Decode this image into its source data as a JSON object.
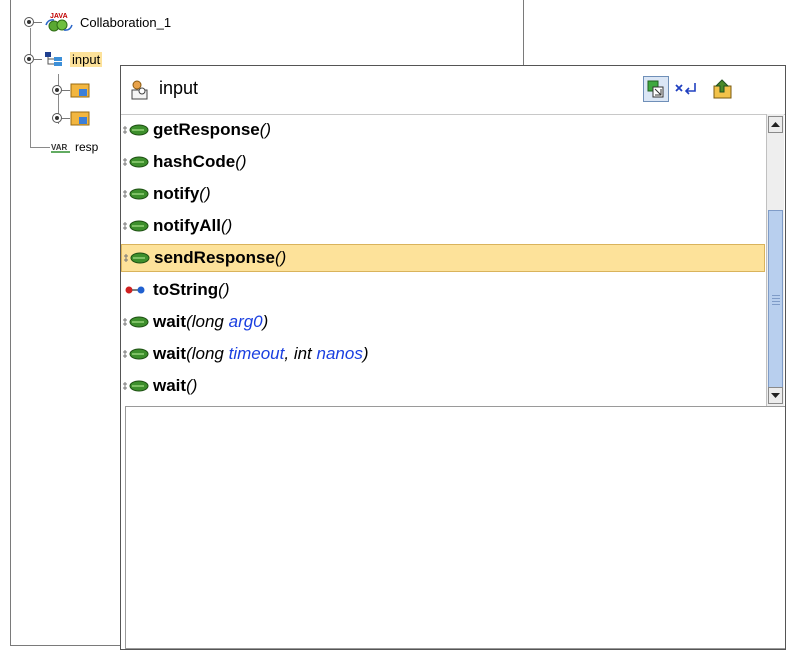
{
  "tree": {
    "root_label": "Collaboration_1",
    "root_badge": "JAVA",
    "input_label": "input",
    "var_label": "resp",
    "var_badge": "VAR"
  },
  "popup": {
    "title": "input",
    "toolbar": [
      "tree-view-icon",
      "clear-filter-icon",
      "go-up-icon"
    ]
  },
  "methods": [
    {
      "name": "getResponse",
      "params": [],
      "icon": "method-icon",
      "selected": false
    },
    {
      "name": "hashCode",
      "params": [],
      "icon": "method-icon",
      "selected": false
    },
    {
      "name": "notify",
      "params": [],
      "icon": "method-icon",
      "selected": false
    },
    {
      "name": "notifyAll",
      "params": [],
      "icon": "method-icon",
      "selected": false
    },
    {
      "name": "sendResponse",
      "params": [],
      "icon": "method-icon",
      "selected": true
    },
    {
      "name": "toString",
      "params": [],
      "icon": "tostring-icon",
      "selected": false
    },
    {
      "name": "wait",
      "params": [
        {
          "type": "long",
          "name": "arg0"
        }
      ],
      "icon": "method-icon",
      "selected": false
    },
    {
      "name": "wait",
      "params": [
        {
          "type": "long",
          "name": "timeout"
        },
        {
          "type": "int",
          "name": "nanos"
        }
      ],
      "icon": "method-icon",
      "selected": false
    },
    {
      "name": "wait",
      "params": [],
      "icon": "method-icon",
      "selected": false
    }
  ],
  "colors": {
    "selection": "#fde29a",
    "param_name": "#1a3fe0",
    "scroll_thumb": "#b8cfee"
  }
}
